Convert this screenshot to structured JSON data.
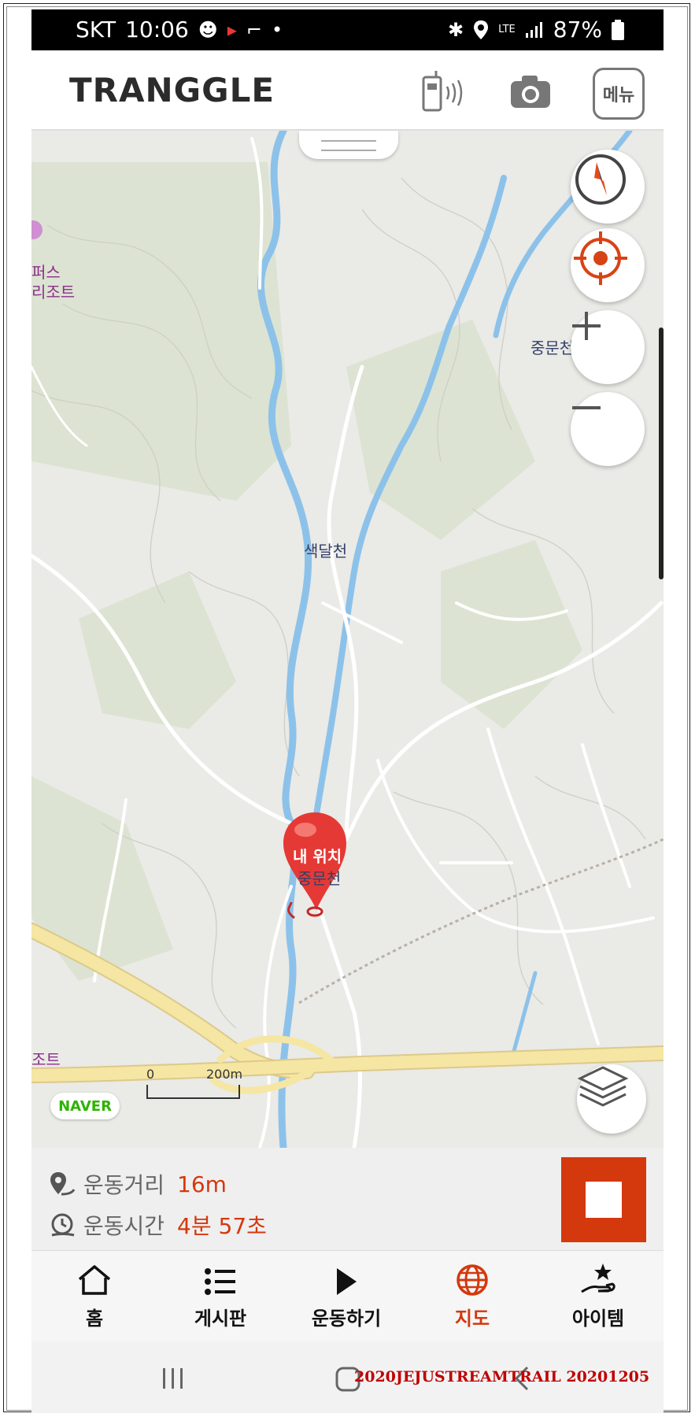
{
  "status_bar": {
    "carrier": "SKT",
    "time": "10:06",
    "network": "LTE",
    "battery": "87%"
  },
  "header": {
    "logo": "TRANGGLE",
    "menu_label": "메뉴"
  },
  "map": {
    "labels": [
      "중문천",
      "색달천",
      "중문천"
    ],
    "poi_lines": [
      "퍼스",
      "리조트"
    ],
    "poi_bottom": "조트",
    "pin_label": "내 위치",
    "provider": "NAVER",
    "scale_zero": "0",
    "scale_max": "200m"
  },
  "stats": {
    "distance_label": "운동거리",
    "distance_value": "16m",
    "time_label": "운동시간",
    "time_value": "4분 57초"
  },
  "nav": {
    "items": [
      {
        "label": "홈",
        "icon": "home-icon"
      },
      {
        "label": "게시판",
        "icon": "list-icon"
      },
      {
        "label": "운동하기",
        "icon": "play-icon"
      },
      {
        "label": "지도",
        "icon": "globe-icon",
        "active": true
      },
      {
        "label": "아이템",
        "icon": "hand-star-icon"
      }
    ]
  },
  "watermark": "2020JEJUSTREAMTRAIL 20201205",
  "colors": {
    "accent": "#d4380d",
    "water": "#8cc2ea",
    "road": "#f5e6a3"
  }
}
